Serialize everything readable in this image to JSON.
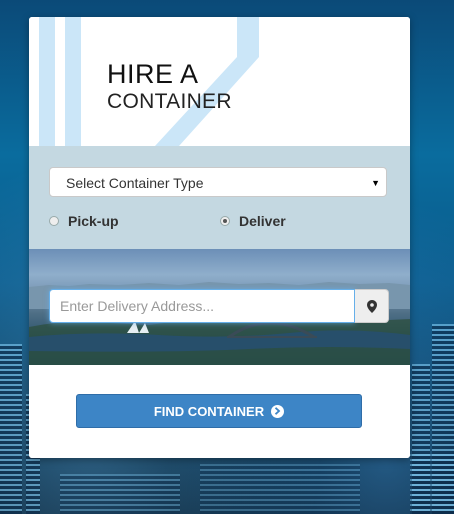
{
  "header": {
    "title_line1": "HIRE A",
    "title_line2": "CONTAINER"
  },
  "form": {
    "container_type": {
      "selected": "Select Container Type"
    },
    "service_options": [
      {
        "label": "Pick-up",
        "checked": false
      },
      {
        "label": "Deliver",
        "checked": true
      }
    ],
    "address": {
      "placeholder": "Enter Delivery Address...",
      "value": "",
      "button_icon": "map-marker-icon"
    },
    "submit": {
      "label": "FIND CONTAINER",
      "icon": "chevron-circle-right-icon"
    }
  },
  "colors": {
    "accent": "#3d85c6",
    "options_panel": "#c4d8e1",
    "hero_stripe": "#cbe6f8"
  }
}
